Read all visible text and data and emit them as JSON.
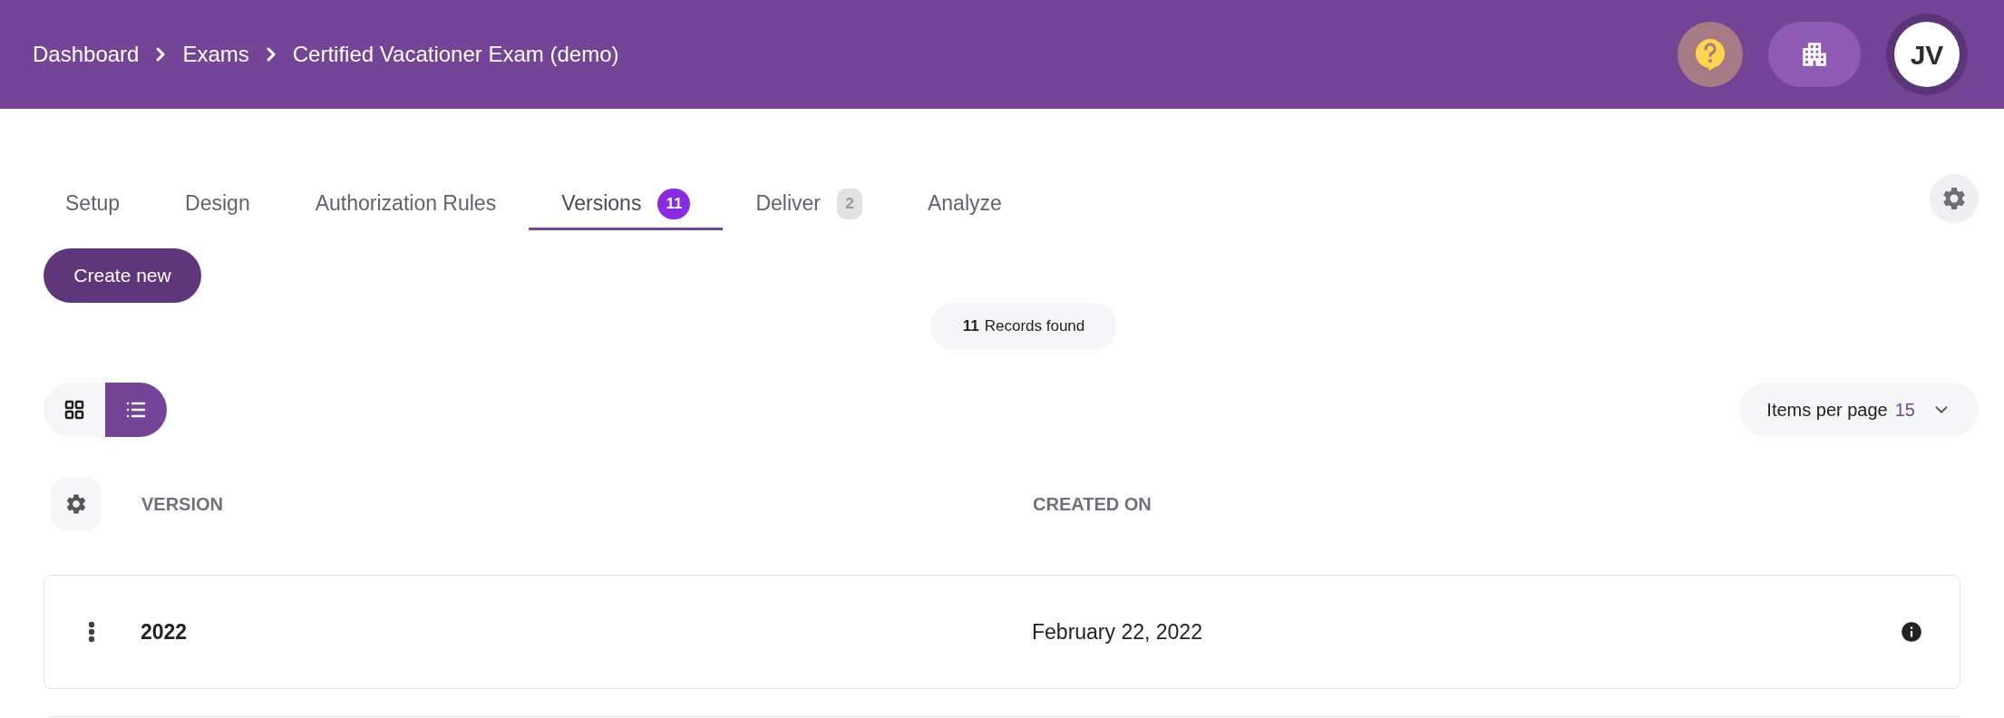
{
  "breadcrumb": [
    {
      "label": "Dashboard"
    },
    {
      "label": "Exams"
    },
    {
      "label": "Certified Vacationer Exam (demo)"
    }
  ],
  "header": {
    "avatar_initials": "JV"
  },
  "tabs": [
    {
      "label": "Setup",
      "selected": false
    },
    {
      "label": "Design",
      "selected": false
    },
    {
      "label": "Authorization Rules",
      "selected": false
    },
    {
      "label": "Versions",
      "badge": "11",
      "selected": true
    },
    {
      "label": "Deliver",
      "badge": "2",
      "selected": false
    },
    {
      "label": "Analyze",
      "selected": false
    }
  ],
  "create_button": "Create new",
  "records": {
    "count": "11",
    "label": "Records found"
  },
  "view_toggle": [
    {
      "kind": "grid",
      "selected": false
    },
    {
      "kind": "list",
      "selected": true
    }
  ],
  "items_per_page": {
    "label": "Items per page",
    "value": "15"
  },
  "table": {
    "columns": [
      "VERSION",
      "CREATED ON"
    ],
    "rows": [
      {
        "version": "2022",
        "created_on": "February 22, 2022"
      }
    ]
  }
}
